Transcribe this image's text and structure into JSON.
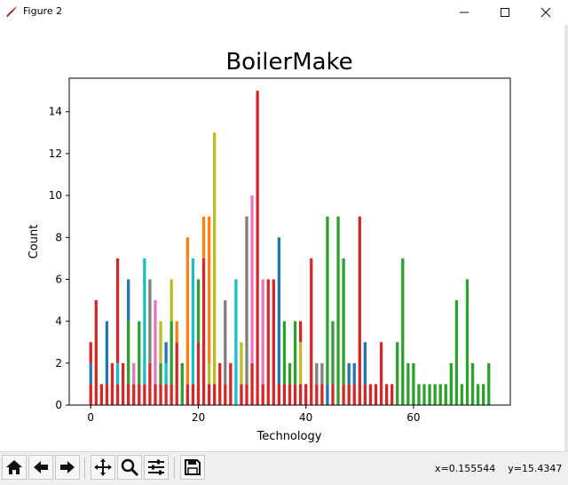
{
  "window": {
    "title": "Figure 2",
    "app_icon": "tk-feather-icon",
    "controls": [
      "minimize-icon",
      "maximize-icon",
      "close-icon"
    ]
  },
  "chart_data": {
    "type": "bar",
    "title": "BoilerMake",
    "xlabel": "Technology",
    "ylabel": "Count",
    "xlim": [
      -4,
      78
    ],
    "ylim": [
      0,
      15.6
    ],
    "xticks": [
      0,
      20,
      40,
      60
    ],
    "yticks": [
      0,
      2,
      4,
      6,
      8,
      10,
      12,
      14
    ],
    "stacked": true,
    "bars": [
      {
        "x": 0,
        "stack": [
          [
            1,
            "#d62728"
          ],
          [
            1,
            "#1f77b4"
          ],
          [
            1,
            "#d62728"
          ]
        ]
      },
      {
        "x": 1,
        "stack": [
          [
            5,
            "#d62728"
          ]
        ]
      },
      {
        "x": 2,
        "stack": [
          [
            1,
            "#d62728"
          ]
        ]
      },
      {
        "x": 3,
        "stack": [
          [
            1,
            "#d62728"
          ],
          [
            3,
            "#1f77b4"
          ]
        ]
      },
      {
        "x": 4,
        "stack": [
          [
            2,
            "#d62728"
          ]
        ]
      },
      {
        "x": 5,
        "stack": [
          [
            1,
            "#d62728"
          ],
          [
            1,
            "#17becf"
          ],
          [
            5,
            "#d62728"
          ]
        ]
      },
      {
        "x": 6,
        "stack": [
          [
            2,
            "#d62728"
          ]
        ]
      },
      {
        "x": 7,
        "stack": [
          [
            1,
            "#d62728"
          ],
          [
            3,
            "#2ca02c"
          ],
          [
            2,
            "#1f77b4"
          ]
        ]
      },
      {
        "x": 8,
        "stack": [
          [
            1,
            "#d62728"
          ],
          [
            1,
            "#e377c2"
          ]
        ]
      },
      {
        "x": 9,
        "stack": [
          [
            1,
            "#d62728"
          ],
          [
            3,
            "#2ca02c"
          ]
        ]
      },
      {
        "x": 10,
        "stack": [
          [
            1,
            "#d62728"
          ],
          [
            6,
            "#17becf"
          ]
        ]
      },
      {
        "x": 11,
        "stack": [
          [
            2,
            "#d62728"
          ],
          [
            4,
            "#7f7f7f"
          ]
        ]
      },
      {
        "x": 12,
        "stack": [
          [
            1,
            "#d62728"
          ],
          [
            4,
            "#e377c2"
          ]
        ]
      },
      {
        "x": 13,
        "stack": [
          [
            1,
            "#d62728"
          ],
          [
            1,
            "#2ca02c"
          ],
          [
            2,
            "#bcbd22"
          ]
        ]
      },
      {
        "x": 14,
        "stack": [
          [
            1,
            "#d62728"
          ],
          [
            1,
            "#17becf"
          ],
          [
            1,
            "#1f77b4"
          ]
        ]
      },
      {
        "x": 15,
        "stack": [
          [
            1,
            "#d62728"
          ],
          [
            3,
            "#2ca02c"
          ],
          [
            2,
            "#bcbd22"
          ]
        ]
      },
      {
        "x": 16,
        "stack": [
          [
            1,
            "#d62728"
          ],
          [
            2,
            "#d62728"
          ],
          [
            1,
            "#ff7f0e"
          ]
        ]
      },
      {
        "x": 17,
        "stack": [
          [
            2,
            "#2ca02c"
          ]
        ]
      },
      {
        "x": 18,
        "stack": [
          [
            1,
            "#d62728"
          ],
          [
            7,
            "#ff7f0e"
          ]
        ]
      },
      {
        "x": 19,
        "stack": [
          [
            1,
            "#d62728"
          ],
          [
            6,
            "#17becf"
          ]
        ]
      },
      {
        "x": 20,
        "stack": [
          [
            1,
            "#d62728"
          ],
          [
            2,
            "#d62728"
          ],
          [
            3,
            "#2ca02c"
          ]
        ]
      },
      {
        "x": 21,
        "stack": [
          [
            7,
            "#d62728"
          ],
          [
            2,
            "#ff7f0e"
          ]
        ]
      },
      {
        "x": 22,
        "stack": [
          [
            1,
            "#d62728"
          ],
          [
            1,
            "#bcbd22"
          ],
          [
            7,
            "#ff7f0e"
          ]
        ]
      },
      {
        "x": 23,
        "stack": [
          [
            1,
            "#d62728"
          ],
          [
            12,
            "#bcbd22"
          ]
        ]
      },
      {
        "x": 24,
        "stack": [
          [
            2,
            "#d62728"
          ]
        ]
      },
      {
        "x": 25,
        "stack": [
          [
            1,
            "#d62728"
          ],
          [
            4,
            "#7f7f7f"
          ]
        ]
      },
      {
        "x": 26,
        "stack": [
          [
            2,
            "#d62728"
          ]
        ]
      },
      {
        "x": 27,
        "stack": [
          [
            1,
            "#17becf"
          ],
          [
            5,
            "#17becf"
          ]
        ]
      },
      {
        "x": 28,
        "stack": [
          [
            1,
            "#d62728"
          ],
          [
            2,
            "#bcbd22"
          ]
        ]
      },
      {
        "x": 29,
        "stack": [
          [
            1,
            "#d62728"
          ],
          [
            8,
            "#7f7f7f"
          ]
        ]
      },
      {
        "x": 30,
        "stack": [
          [
            1,
            "#d62728"
          ],
          [
            1,
            "#d62728"
          ],
          [
            8,
            "#e377c2"
          ]
        ]
      },
      {
        "x": 31,
        "stack": [
          [
            15,
            "#d62728"
          ]
        ]
      },
      {
        "x": 32,
        "stack": [
          [
            1,
            "#d62728"
          ],
          [
            5,
            "#e377c2"
          ]
        ]
      },
      {
        "x": 33,
        "stack": [
          [
            6,
            "#d62728"
          ]
        ]
      },
      {
        "x": 34,
        "stack": [
          [
            1,
            "#d62728"
          ],
          [
            5,
            "#d62728"
          ]
        ]
      },
      {
        "x": 35,
        "stack": [
          [
            1,
            "#d62728"
          ],
          [
            7,
            "#1f77b4"
          ]
        ]
      },
      {
        "x": 36,
        "stack": [
          [
            1,
            "#d62728"
          ],
          [
            3,
            "#2ca02c"
          ]
        ]
      },
      {
        "x": 37,
        "stack": [
          [
            1,
            "#d62728"
          ],
          [
            1,
            "#2ca02c"
          ]
        ]
      },
      {
        "x": 38,
        "stack": [
          [
            1,
            "#d62728"
          ],
          [
            3,
            "#2ca02c"
          ]
        ]
      },
      {
        "x": 39,
        "stack": [
          [
            1,
            "#d62728"
          ],
          [
            2,
            "#bcbd22"
          ],
          [
            1,
            "#d62728"
          ]
        ]
      },
      {
        "x": 40,
        "stack": [
          [
            1,
            "#d62728"
          ]
        ]
      },
      {
        "x": 41,
        "stack": [
          [
            7,
            "#d62728"
          ]
        ]
      },
      {
        "x": 42,
        "stack": [
          [
            1,
            "#d62728"
          ],
          [
            1,
            "#7f7f7f"
          ]
        ]
      },
      {
        "x": 43,
        "stack": [
          [
            1,
            "#d62728"
          ],
          [
            1,
            "#7f7f7f"
          ]
        ]
      },
      {
        "x": 44,
        "stack": [
          [
            1,
            "#1f77b4"
          ],
          [
            8,
            "#2ca02c"
          ]
        ]
      },
      {
        "x": 45,
        "stack": [
          [
            1,
            "#d62728"
          ],
          [
            3,
            "#2ca02c"
          ]
        ]
      },
      {
        "x": 46,
        "stack": [
          [
            9,
            "#2ca02c"
          ]
        ]
      },
      {
        "x": 47,
        "stack": [
          [
            1,
            "#d62728"
          ],
          [
            6,
            "#2ca02c"
          ]
        ]
      },
      {
        "x": 48,
        "stack": [
          [
            1,
            "#d62728"
          ],
          [
            1,
            "#1f77b4"
          ]
        ]
      },
      {
        "x": 49,
        "stack": [
          [
            1,
            "#d62728"
          ],
          [
            1,
            "#1f77b4"
          ]
        ]
      },
      {
        "x": 50,
        "stack": [
          [
            9,
            "#d62728"
          ]
        ]
      },
      {
        "x": 51,
        "stack": [
          [
            1,
            "#d62728"
          ],
          [
            2,
            "#1f77b4"
          ]
        ]
      },
      {
        "x": 52,
        "stack": [
          [
            1,
            "#d62728"
          ]
        ]
      },
      {
        "x": 53,
        "stack": [
          [
            1,
            "#d62728"
          ]
        ]
      },
      {
        "x": 54,
        "stack": [
          [
            3,
            "#d62728"
          ]
        ]
      },
      {
        "x": 55,
        "stack": [
          [
            1,
            "#d62728"
          ]
        ]
      },
      {
        "x": 56,
        "stack": [
          [
            1,
            "#d62728"
          ]
        ]
      },
      {
        "x": 57,
        "stack": [
          [
            3,
            "#2ca02c"
          ]
        ]
      },
      {
        "x": 58,
        "stack": [
          [
            7,
            "#2ca02c"
          ]
        ]
      },
      {
        "x": 59,
        "stack": [
          [
            2,
            "#2ca02c"
          ]
        ]
      },
      {
        "x": 60,
        "stack": [
          [
            2,
            "#2ca02c"
          ]
        ]
      },
      {
        "x": 61,
        "stack": [
          [
            1,
            "#2ca02c"
          ]
        ]
      },
      {
        "x": 62,
        "stack": [
          [
            1,
            "#2ca02c"
          ]
        ]
      },
      {
        "x": 63,
        "stack": [
          [
            1,
            "#2ca02c"
          ]
        ]
      },
      {
        "x": 64,
        "stack": [
          [
            1,
            "#2ca02c"
          ]
        ]
      },
      {
        "x": 65,
        "stack": [
          [
            1,
            "#2ca02c"
          ]
        ]
      },
      {
        "x": 66,
        "stack": [
          [
            1,
            "#2ca02c"
          ]
        ]
      },
      {
        "x": 67,
        "stack": [
          [
            2,
            "#2ca02c"
          ]
        ]
      },
      {
        "x": 68,
        "stack": [
          [
            5,
            "#2ca02c"
          ]
        ]
      },
      {
        "x": 69,
        "stack": [
          [
            1,
            "#2ca02c"
          ]
        ]
      },
      {
        "x": 70,
        "stack": [
          [
            6,
            "#2ca02c"
          ]
        ]
      },
      {
        "x": 71,
        "stack": [
          [
            2,
            "#2ca02c"
          ]
        ]
      },
      {
        "x": 72,
        "stack": [
          [
            1,
            "#2ca02c"
          ]
        ]
      },
      {
        "x": 73,
        "stack": [
          [
            1,
            "#2ca02c"
          ]
        ]
      },
      {
        "x": 74,
        "stack": [
          [
            2,
            "#2ca02c"
          ]
        ]
      }
    ]
  },
  "toolbar": {
    "buttons": [
      {
        "name": "home-icon",
        "glyph": "🏠"
      },
      {
        "name": "back-icon",
        "glyph": "←"
      },
      {
        "name": "forward-icon",
        "glyph": "→"
      },
      {
        "name": "pan-icon",
        "glyph": "✥"
      },
      {
        "name": "zoom-icon",
        "glyph": "🔍"
      },
      {
        "name": "configure-subplots-icon",
        "glyph": "☰"
      },
      {
        "name": "save-icon",
        "glyph": "💾"
      }
    ],
    "coords": "x=0.155544    y=15.4347"
  }
}
